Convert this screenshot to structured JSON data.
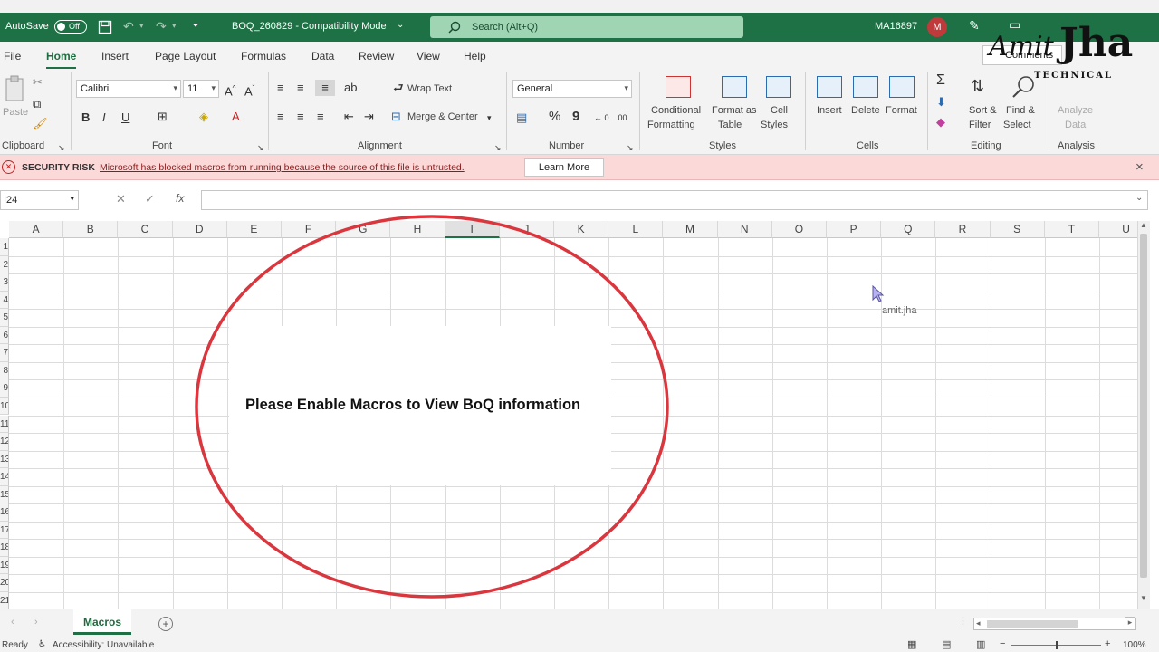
{
  "titlebar": {
    "autosave_label": "AutoSave",
    "autosave_state": "Off",
    "doc_title": "BOQ_260829  -  Compatibility Mode",
    "search_placeholder": "Search (Alt+Q)",
    "user_id": "MA16897",
    "avatar_letter": "M"
  },
  "tabs": [
    "File",
    "Home",
    "Insert",
    "Page Layout",
    "Formulas",
    "Data",
    "Review",
    "View",
    "Help"
  ],
  "ribbon": {
    "clipboard": {
      "paste": "Paste",
      "label": "Clipboard"
    },
    "font": {
      "name": "Calibri",
      "size": "11",
      "label": "Font"
    },
    "alignment": {
      "wrap_text": "Wrap Text",
      "merge_center": "Merge & Center",
      "label": "Alignment"
    },
    "number": {
      "format": "General",
      "percent": "%",
      "comma": "9",
      "label": "Number"
    },
    "styles": {
      "conditional_1": "Conditional",
      "conditional_2": "Formatting",
      "format_table_1": "Format as",
      "format_table_2": "Table",
      "cell_styles_1": "Cell",
      "cell_styles_2": "Styles",
      "label": "Styles"
    },
    "cells": {
      "insert": "Insert",
      "delete": "Delete",
      "format": "Format",
      "label": "Cells"
    },
    "editing": {
      "sort_1": "Sort &",
      "sort_2": "Filter",
      "find_1": "Find &",
      "find_2": "Select",
      "label": "Editing"
    },
    "analysis": {
      "analyze_1": "Analyze",
      "analyze_2": "Data",
      "label": "Analysis"
    },
    "comments": "Comments"
  },
  "security_bar": {
    "title": "SECURITY RISK",
    "message": "Microsoft has blocked macros from running because the source of this file is untrusted.",
    "button": "Learn More",
    "close": "×"
  },
  "formula_bar": {
    "name_box": "I24",
    "fx": "fx",
    "value": ""
  },
  "grid": {
    "columns": [
      "A",
      "B",
      "C",
      "D",
      "E",
      "F",
      "G",
      "H",
      "I",
      "J",
      "K",
      "L",
      "M",
      "N",
      "O",
      "P",
      "Q",
      "R",
      "S",
      "T",
      "U"
    ],
    "selected_column": "I",
    "rows": [
      "1",
      "2",
      "3",
      "4",
      "5",
      "6",
      "7",
      "8",
      "9",
      "10",
      "11",
      "12",
      "13",
      "14",
      "15",
      "16",
      "17",
      "18",
      "19",
      "20",
      "21"
    ],
    "message": "Please Enable Macros to View BoQ information",
    "cursor_label": "amit.jha"
  },
  "sheets": {
    "active": "Macros",
    "add": "+"
  },
  "statusbar": {
    "ready": "Ready",
    "accessibility": "Accessibility: Unavailable",
    "zoom": "100%"
  },
  "watermark": {
    "line1": "Amit",
    "line2": "Jha",
    "line3": "TECHNICAL"
  },
  "colors": {
    "excel_green": "#1e7145",
    "annotation_red": "#d9363e",
    "security_bg": "#fbd9d9"
  }
}
